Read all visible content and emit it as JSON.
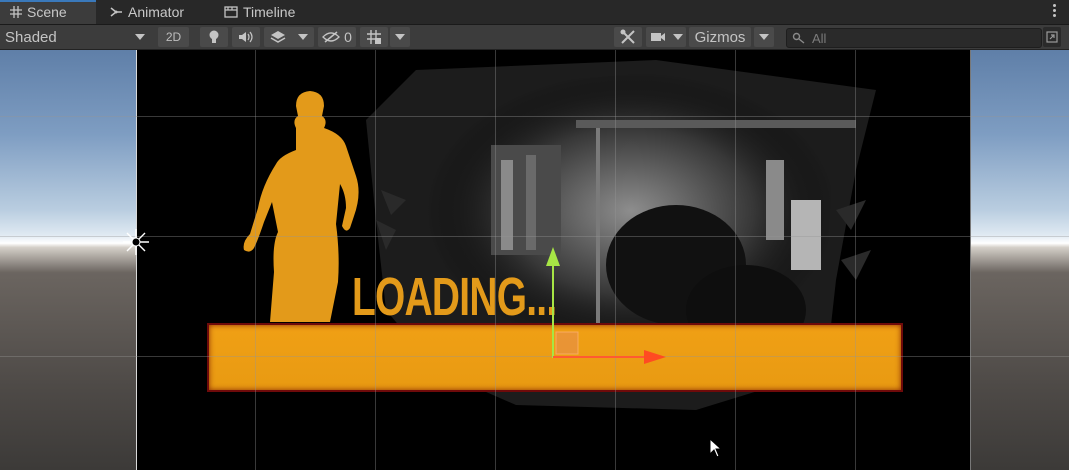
{
  "tabs": [
    {
      "label": "Scene",
      "icon": "grid-icon",
      "active": true
    },
    {
      "label": "Animator",
      "icon": "animator-icon",
      "active": false
    },
    {
      "label": "Timeline",
      "icon": "timeline-icon",
      "active": false
    }
  ],
  "toolbar": {
    "shading_mode": "Shaded",
    "mode_2d": "2D",
    "hidden_count": "0",
    "gizmos_label": "Gizmos",
    "search_placeholder": "All"
  },
  "scene": {
    "loading_text": "LOADING...",
    "accent_color": "#e39a1a",
    "bar_border_color": "#6e0a0a"
  }
}
